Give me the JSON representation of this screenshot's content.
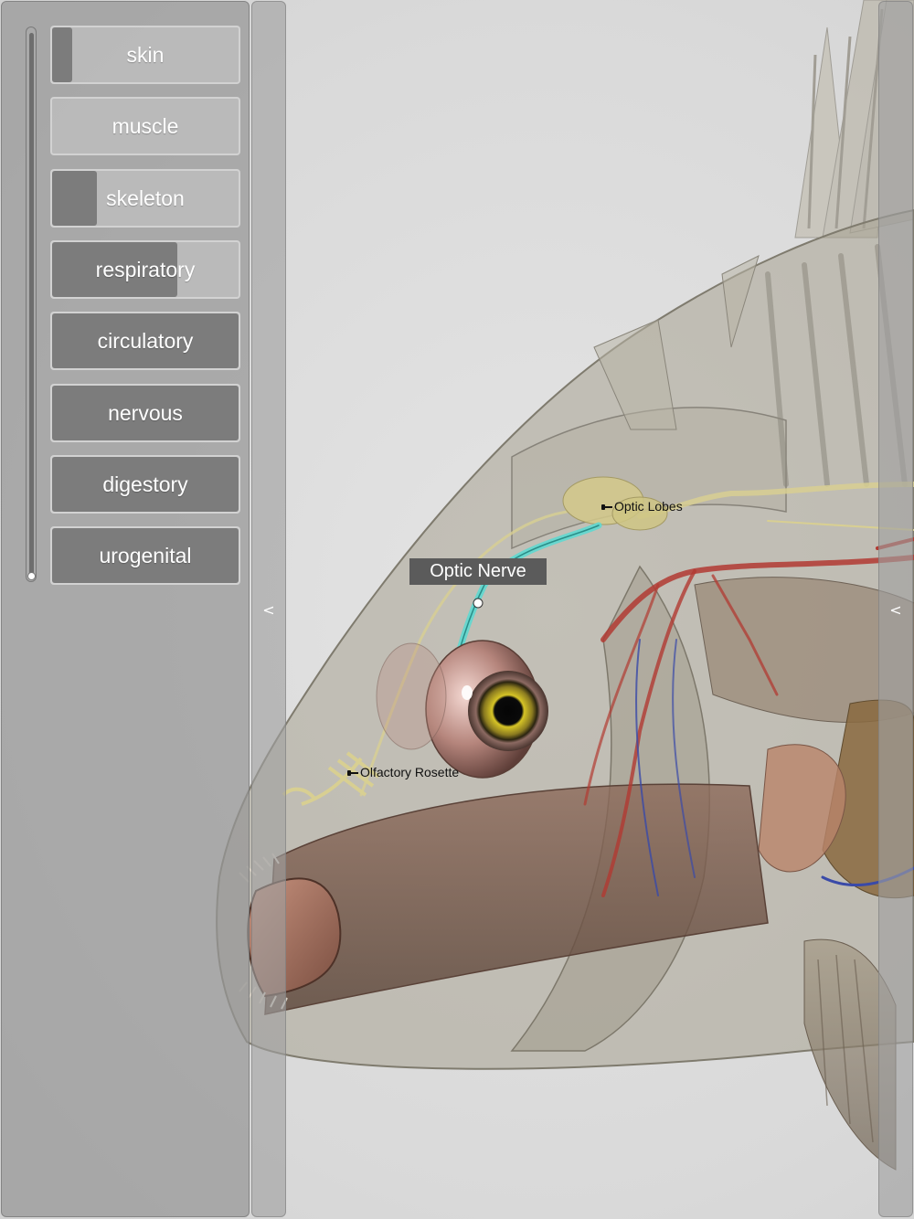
{
  "layers": [
    {
      "label": "skin",
      "opacity": 0.11
    },
    {
      "label": "muscle",
      "opacity": 0.0
    },
    {
      "label": "skeleton",
      "opacity": 0.24
    },
    {
      "label": "respiratory",
      "opacity": 0.67
    },
    {
      "label": "circulatory",
      "opacity": 1.0
    },
    {
      "label": "nervous",
      "opacity": 1.0
    },
    {
      "label": "digestory",
      "opacity": 1.0
    },
    {
      "label": "urogenital",
      "opacity": 1.0
    }
  ],
  "master_slider": {
    "value": 1.0
  },
  "collapse_left": {
    "chevron": "<"
  },
  "collapse_right": {
    "chevron": "<"
  },
  "selected_callout": {
    "label": "Optic Nerve"
  },
  "annotations": {
    "optic_lobes": "Optic Lobes",
    "olfactory_rosette": "Olfactory Rosette"
  },
  "colors": {
    "panel_bg": "#969696",
    "button_fill": "#7c7c7c",
    "callout_bg": "#5b5b5b",
    "nerve_highlight": "#5fd8d0",
    "artery": "#b23a32",
    "vein": "#3a4aa8"
  }
}
